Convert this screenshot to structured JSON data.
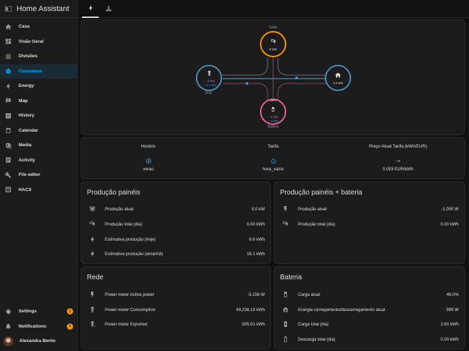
{
  "app": {
    "title": "Home Assistant"
  },
  "sidebar": {
    "items": [
      {
        "label": "Casa",
        "icon": "home-icon"
      },
      {
        "label": "Visão Geral",
        "icon": "dashboard-icon"
      },
      {
        "label": "Divisões",
        "icon": "sofa-icon"
      },
      {
        "label": "Consumos",
        "icon": "home-lightning-icon",
        "active": true
      },
      {
        "label": "Energy",
        "icon": "lightning-bolt-icon"
      },
      {
        "label": "Map",
        "icon": "map-icon"
      },
      {
        "label": "History",
        "icon": "chart-box-icon"
      },
      {
        "label": "Calendar",
        "icon": "calendar-icon"
      },
      {
        "label": "Media",
        "icon": "media-icon"
      },
      {
        "label": "Activity",
        "icon": "activity-icon"
      },
      {
        "label": "File editor",
        "icon": "wrench-icon"
      },
      {
        "label": "HACS",
        "icon": "hacs-icon"
      }
    ],
    "settings": {
      "label": "Settings",
      "badge": "1"
    },
    "notifications": {
      "label": "Notifications",
      "badge": "1"
    },
    "user": {
      "name": "Alexandra Bento"
    }
  },
  "tabs": [
    {
      "icon": "lightning-bolt-icon",
      "active": true
    },
    {
      "icon": "sitemap-icon",
      "active": false
    }
  ],
  "energy_flow": {
    "solar": {
      "label": "Solar",
      "value": "0 kW",
      "color": "#ff9800"
    },
    "grid": {
      "label": "Grid",
      "in": "← 0 kW",
      "out": "→ 5.2 kW",
      "color": "#488fc2"
    },
    "home": {
      "value": "4.2 kW",
      "color": "#488fc2"
    },
    "battery": {
      "label": "Battery",
      "percent": "46%",
      "in": "↓ 1 kW",
      "out": "↑ 0 kW",
      "color": "#f06292"
    }
  },
  "tariff": {
    "columns": [
      {
        "header": "Horário",
        "icon": "calendar-clock-icon",
        "value": "verao"
      },
      {
        "header": "Tarifa",
        "icon": "home-currency-icon",
        "value": "hora_vazio"
      },
      {
        "header": "Preço Atual Tarifa (kWh/EUR)",
        "icon": "transmission-tower-arrow-icon",
        "value": "0.093 EUR/kWh"
      }
    ]
  },
  "cards": {
    "producao": {
      "title": "Produção painéis",
      "rows": [
        {
          "icon": "solar-panel-icon",
          "name": "Produção atual",
          "value": "0.0 kW"
        },
        {
          "icon": "solar-power-icon",
          "name": "Produção total (dia)",
          "value": "0.00 kWh"
        },
        {
          "icon": "lightning-bolt-icon",
          "name": "Estimativa produção (hoje)",
          "value": "6.6 kWh"
        },
        {
          "icon": "lightning-bolt-icon",
          "name": "Estimativa produção (amanhã)",
          "value": "16.1 kWh"
        }
      ]
    },
    "producao_bateria": {
      "title": "Produção painéis + bateria",
      "rows": [
        {
          "icon": "flash-icon",
          "name": "Produção atual",
          "value": "-1,000 W"
        },
        {
          "icon": "solar-power-icon",
          "name": "Produção total (dia)",
          "value": "0.00 kWh"
        }
      ]
    },
    "rede": {
      "title": "Rede",
      "rows": [
        {
          "icon": "flash-icon",
          "name": "Power meter Active power",
          "value": "-5,156 W"
        },
        {
          "icon": "transmission-tower-import-icon",
          "name": "Power meter Consumption",
          "value": "49,238.19 kWh"
        },
        {
          "icon": "transmission-tower-export-icon",
          "name": "Power meter Exported",
          "value": "505.01 kWh"
        }
      ]
    },
    "bateria": {
      "title": "Bateria",
      "rows": [
        {
          "icon": "battery-icon",
          "name": "Carga atual",
          "value": "46.0%"
        },
        {
          "icon": "home-battery-icon",
          "name": "Energia carregamento/descarregamento atual",
          "value": "999 W"
        },
        {
          "icon": "battery-charging-icon",
          "name": "Carga total (dia)",
          "value": "2.60 kWh"
        },
        {
          "icon": "battery-outline-icon",
          "name": "Descarga total (dia)",
          "value": "0.00 kWh"
        }
      ]
    }
  }
}
